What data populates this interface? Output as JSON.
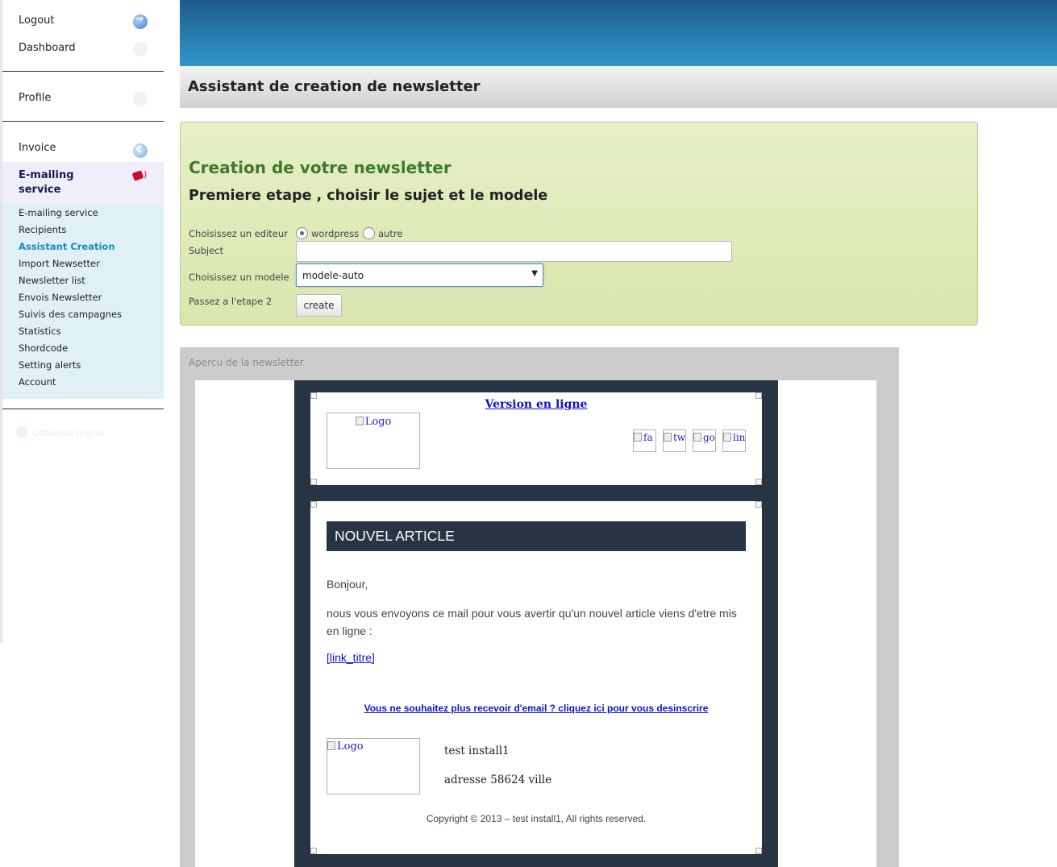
{
  "sidebar": {
    "logout": "Logout",
    "dashboard": "Dashboard",
    "profile": "Profile",
    "invoice": "Invoice",
    "emailing": "E-mailing service",
    "sub_items": [
      "E-mailing service",
      "Recipients",
      "Assistant Creation",
      "Import Newsetter",
      "Newsletter list",
      "Envois Newsletter",
      "Suivis des campagnes",
      "Statistics",
      "Shordcode",
      "Setting alerts",
      "Account"
    ],
    "active_item": "Assistant Creation",
    "collapse": "Collapse menu"
  },
  "header": {
    "title": "Assistant de creation de newsletter"
  },
  "wizard": {
    "title": "Creation de votre newsletter",
    "subtitle": "Premiere etape , choisir le sujet et le modele",
    "editor_label": "Choisissez un editeur",
    "editor_options": [
      "wordpress",
      "autre"
    ],
    "editor_selected": "wordpress",
    "subject_label": "Subject",
    "subject_value": "",
    "model_label": "Choisissez un modele",
    "model_value": "modele-auto",
    "step_label": "Passez a l'etape 2",
    "create_button": "create"
  },
  "preview": {
    "title": "Apercu de la newsletter",
    "version_link": "Version en ligne",
    "logo_alt": "Logo",
    "social_alts": [
      "fa",
      "tw",
      "go",
      "lin"
    ],
    "article_title": "NOUVEL ARTICLE",
    "greeting": "Bonjour,",
    "message": "nous vous envoyons ce mail pour vous avertir qu'un nouvel article viens d'etre mis en ligne :",
    "link_titre": "[link_titre]",
    "unsubscribe": "Vous ne souhaitez plus recevoir d'email ? cliquez ici pour vous desinscrire",
    "footer_logo_alt": "Logo",
    "company_name": "test install1",
    "company_address": "adresse 58624 ville",
    "copyright": "Copyright © 2013 – test install1, All rights reserved."
  },
  "colors": {
    "banner_top": "#1f5b8a",
    "banner_bottom": "#2f97cc",
    "newsletter_frame": "#263443",
    "wizard_title": "#3d7a2a",
    "active_link": "#1a8ab8"
  }
}
